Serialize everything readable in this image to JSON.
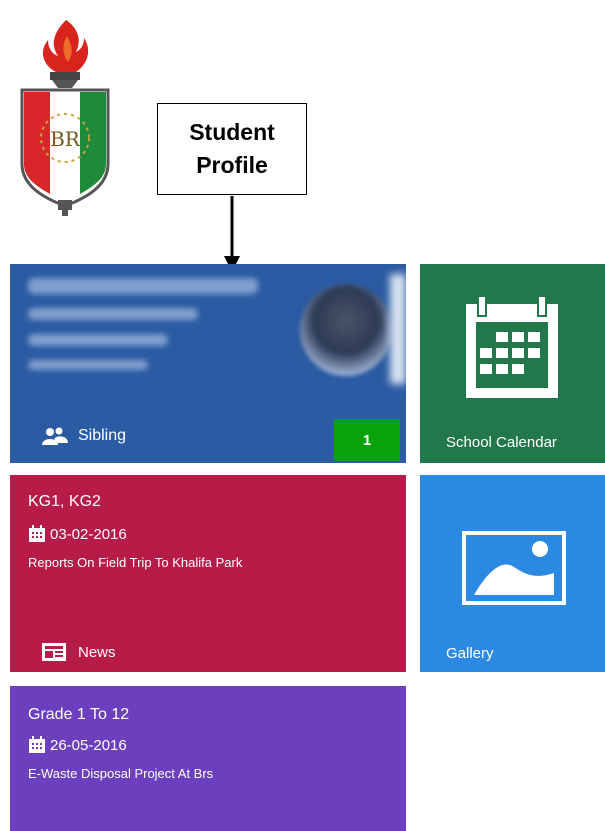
{
  "callout": {
    "line1": "Student",
    "line2": "Profile"
  },
  "logo": {
    "text": "BR"
  },
  "profile_tile": {
    "sibling_label": "Sibling",
    "sibling_count": "1"
  },
  "calendar_tile": {
    "label": "School Calendar",
    "icon": "calendar-icon"
  },
  "news_tile": {
    "grades": "KG1, KG2",
    "date": "03-02-2016",
    "headline": "Reports On Field Trip To Khalifa Park",
    "label": "News"
  },
  "gallery_tile": {
    "label": "Gallery",
    "icon": "image-icon"
  },
  "grade_tile": {
    "grades": "Grade 1 To 12",
    "date": "26-05-2016",
    "headline": "E-Waste Disposal Project At Brs"
  },
  "colors": {
    "profile": "#2b5ba2",
    "calendar": "#22784a",
    "news": "#b71c49",
    "gallery": "#2b89e2",
    "grade": "#6b3fbe",
    "badge": "#0aa20a"
  }
}
